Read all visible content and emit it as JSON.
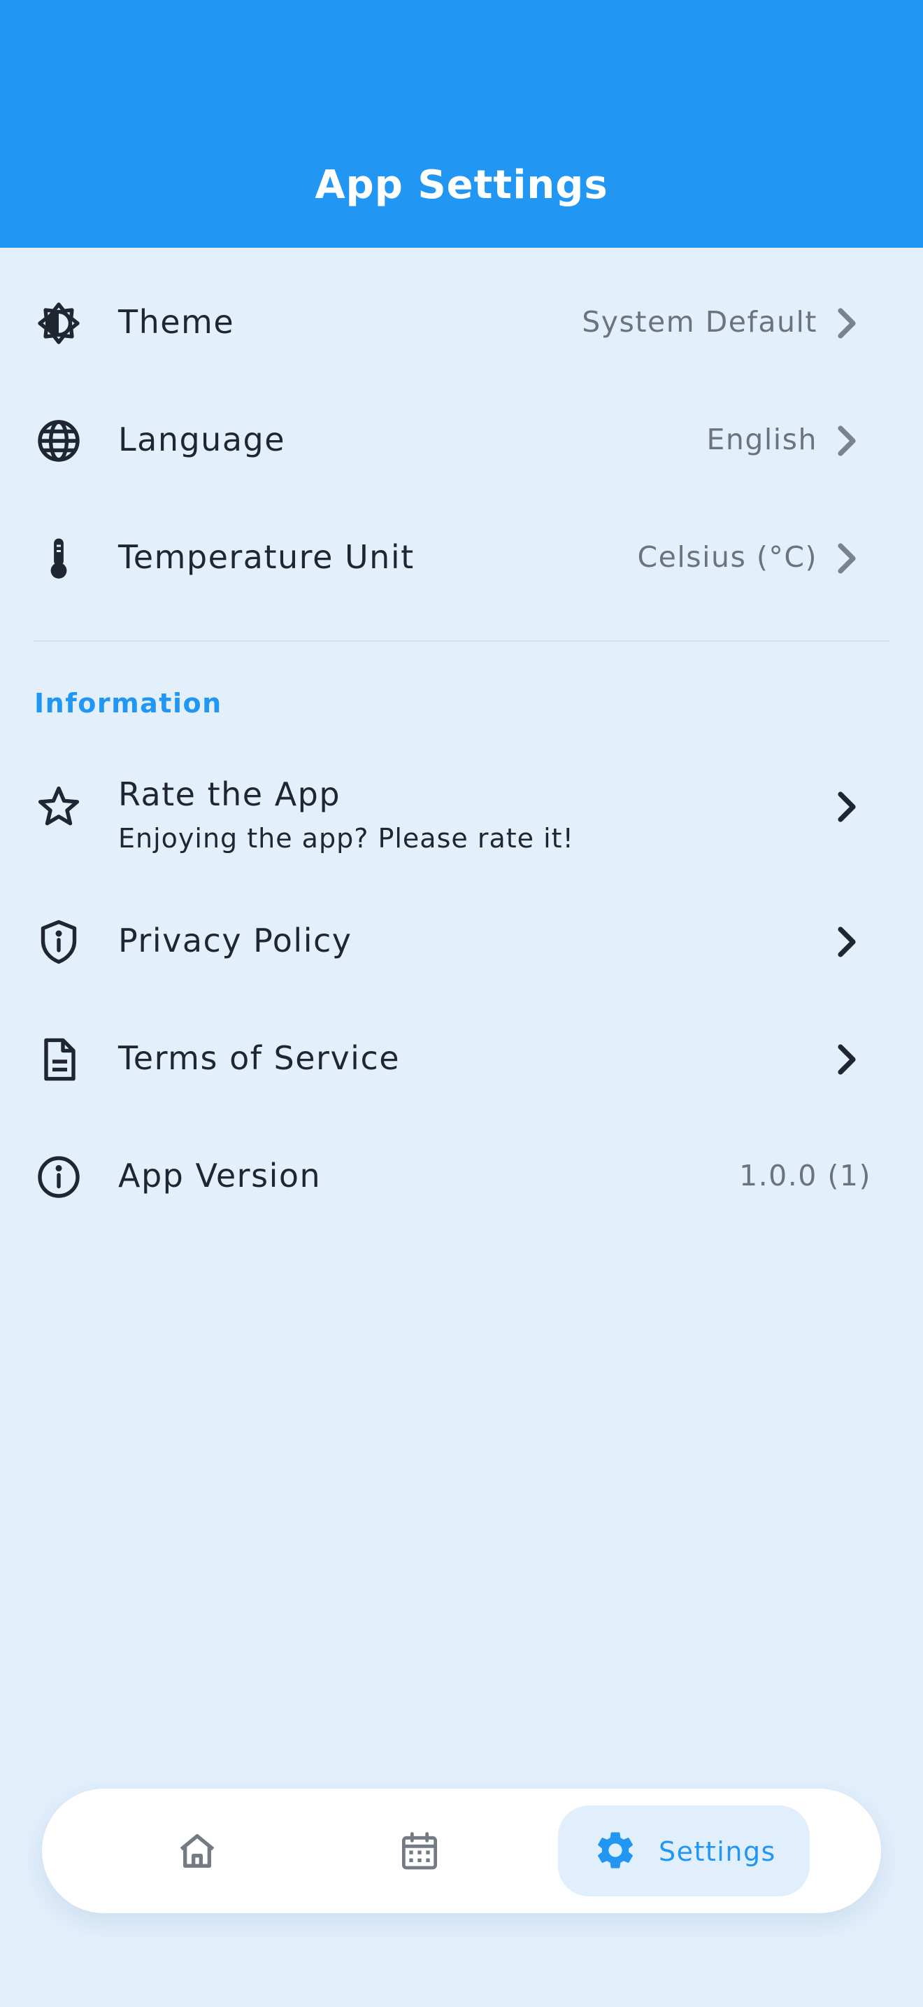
{
  "header": {
    "title": "App Settings"
  },
  "preferences": [
    {
      "icon": "theme-icon",
      "label": "Theme",
      "value": "System Default"
    },
    {
      "icon": "globe-icon",
      "label": "Language",
      "value": "English"
    },
    {
      "icon": "thermometer-icon",
      "label": "Temperature Unit",
      "value": "Celsius (°C)"
    }
  ],
  "information": {
    "header": "Information",
    "items": [
      {
        "icon": "star-icon",
        "label": "Rate the App",
        "sublabel": "Enjoying the app? Please rate it!"
      },
      {
        "icon": "shield-icon",
        "label": "Privacy Policy"
      },
      {
        "icon": "document-icon",
        "label": "Terms of Service"
      },
      {
        "icon": "info-icon",
        "label": "App Version",
        "value": "1.0.0 (1)"
      }
    ]
  },
  "bottom_nav": {
    "items": [
      {
        "icon": "home-icon",
        "label": ""
      },
      {
        "icon": "calendar-icon",
        "label": ""
      },
      {
        "icon": "gear-icon",
        "label": "Settings",
        "selected": true
      }
    ]
  },
  "colors": {
    "primary": "#2196f3",
    "background": "#e3f0fc",
    "text": "#1f2630",
    "muted_text": "#6b737d"
  }
}
